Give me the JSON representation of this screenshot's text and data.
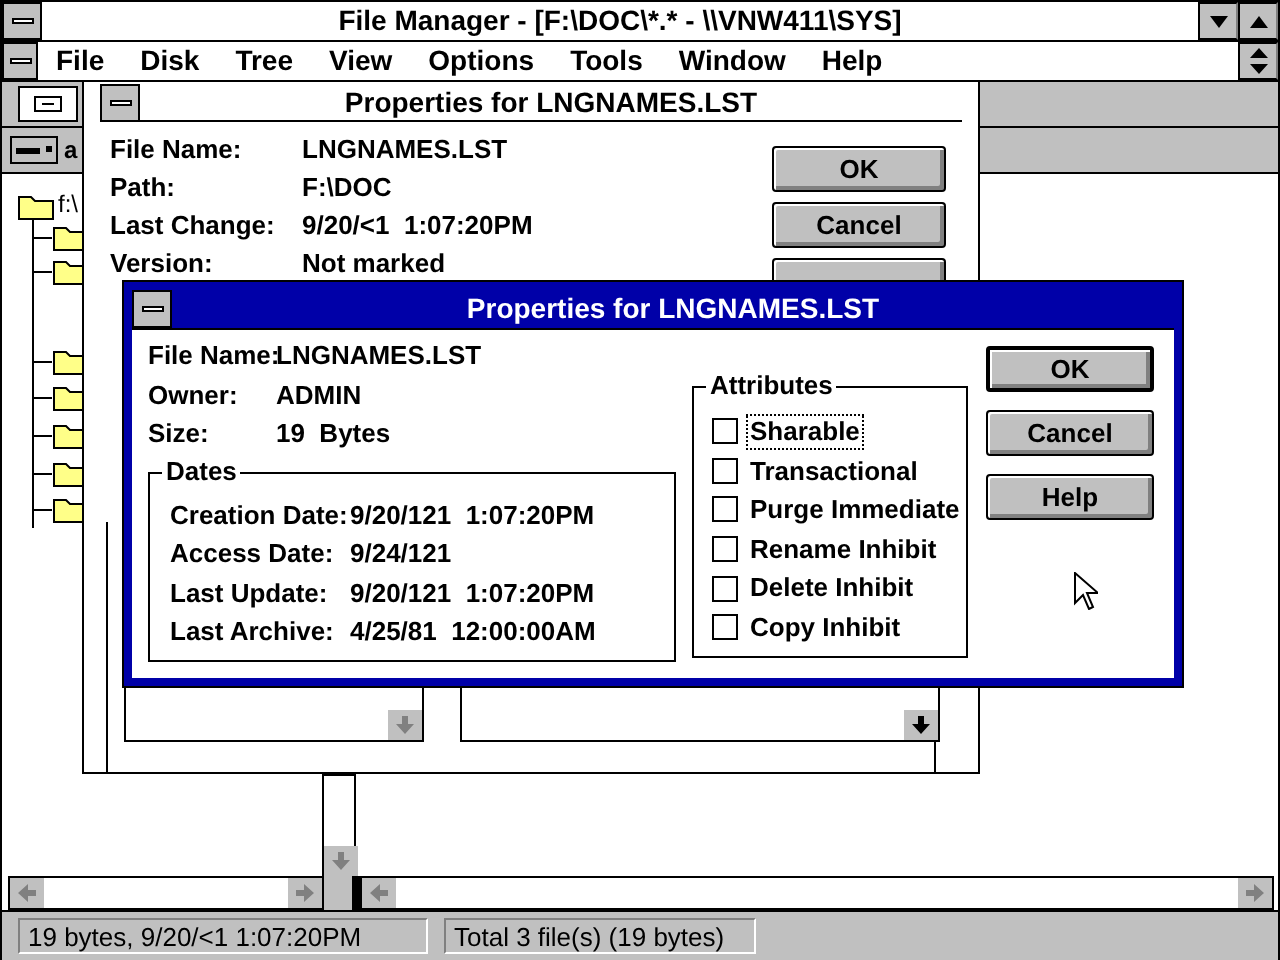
{
  "window": {
    "title": "File Manager - [F:\\DOC\\*.* - \\\\VNW411\\SYS]"
  },
  "menu": [
    "File",
    "Disk",
    "Tree",
    "View",
    "Options",
    "Tools",
    "Window",
    "Help"
  ],
  "drive_bar": {
    "label": "a"
  },
  "tree": {
    "root": "f:\\"
  },
  "back_dialog": {
    "title": "Properties for LNGNAMES.LST",
    "active": false,
    "fields": [
      {
        "label": "File Name:",
        "value": "LNGNAMES.LST"
      },
      {
        "label": "Path:",
        "value": "F:\\DOC"
      },
      {
        "label": "Last Change:",
        "value": "9/20/<1  1:07:20PM"
      },
      {
        "label": "Version:",
        "value": "Not marked"
      }
    ],
    "buttons": [
      "OK",
      "Cancel"
    ]
  },
  "front_dialog": {
    "title": "Properties for LNGNAMES.LST",
    "active": true,
    "fields": [
      {
        "label": "File Name:",
        "value": "LNGNAMES.LST"
      },
      {
        "label": "Owner:",
        "value": "ADMIN"
      },
      {
        "label": "Size:",
        "value": "19  Bytes"
      }
    ],
    "dates": {
      "title": "Dates",
      "rows": [
        {
          "label": "Creation Date:",
          "value": "9/20/121  1:07:20PM"
        },
        {
          "label": "Access Date:",
          "value": "9/24/121"
        },
        {
          "label": "Last Update:",
          "value": "9/20/121  1:07:20PM"
        },
        {
          "label": "Last Archive:",
          "value": "4/25/81  12:00:00AM"
        }
      ]
    },
    "attributes": {
      "title": "Attributes",
      "items": [
        {
          "label": "Sharable",
          "checked": false,
          "focused": true
        },
        {
          "label": "Transactional",
          "checked": false,
          "focused": false
        },
        {
          "label": "Purge Immediate",
          "checked": false,
          "focused": false
        },
        {
          "label": "Rename Inhibit",
          "checked": false,
          "focused": false
        },
        {
          "label": "Delete Inhibit",
          "checked": false,
          "focused": false
        },
        {
          "label": "Copy Inhibit",
          "checked": false,
          "focused": false
        }
      ]
    },
    "buttons": [
      {
        "label": "OK",
        "default": true
      },
      {
        "label": "Cancel",
        "default": false
      },
      {
        "label": "Help",
        "default": false
      }
    ]
  },
  "status_bar": [
    "19 bytes, 9/20/<1 1:07:20PM",
    "Total 3 file(s) (19 bytes)"
  ]
}
